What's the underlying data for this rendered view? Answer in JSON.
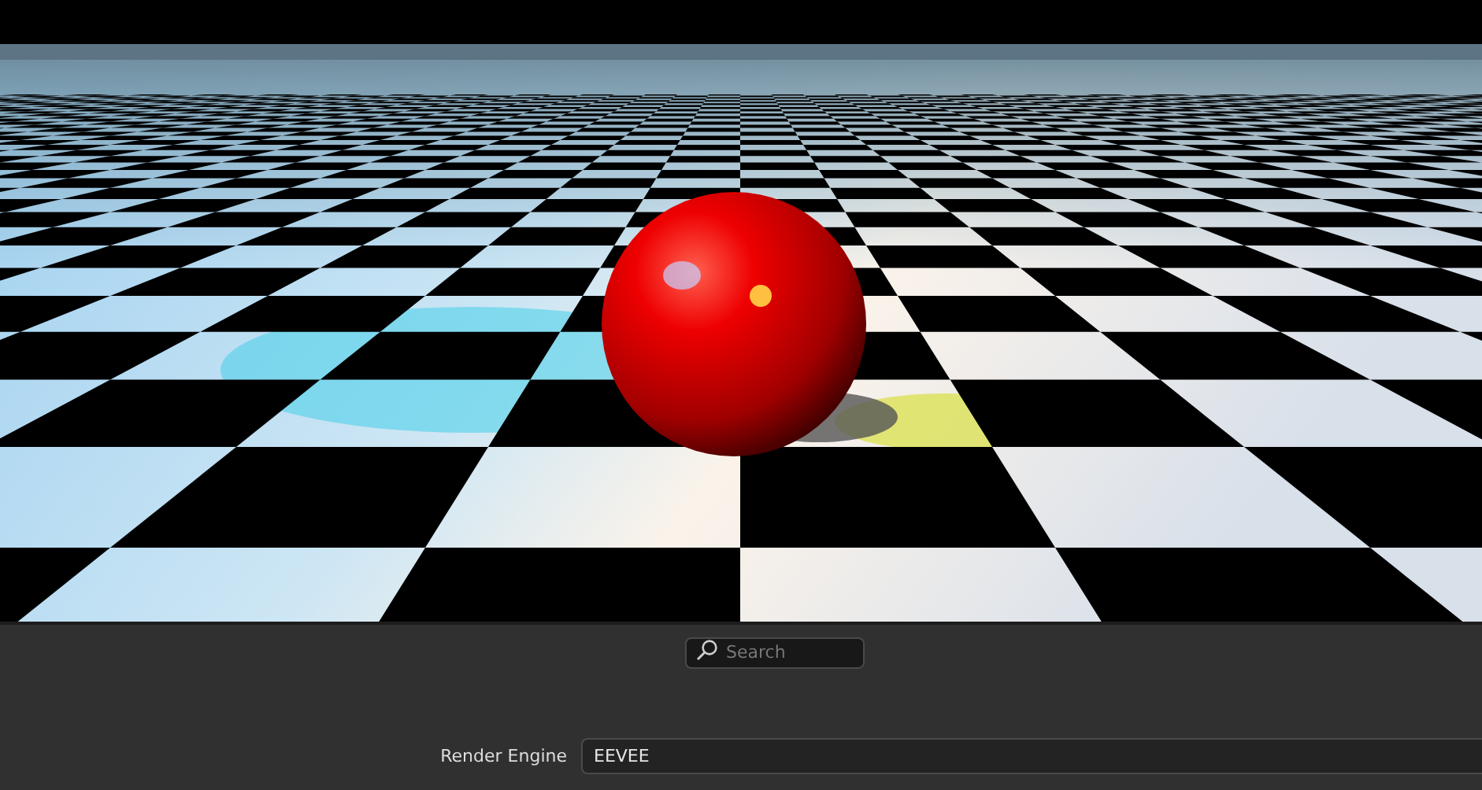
{
  "search": {
    "placeholder": "Search"
  },
  "properties": [
    {
      "label": "Render Engine",
      "value": "EEVEE"
    }
  ]
}
